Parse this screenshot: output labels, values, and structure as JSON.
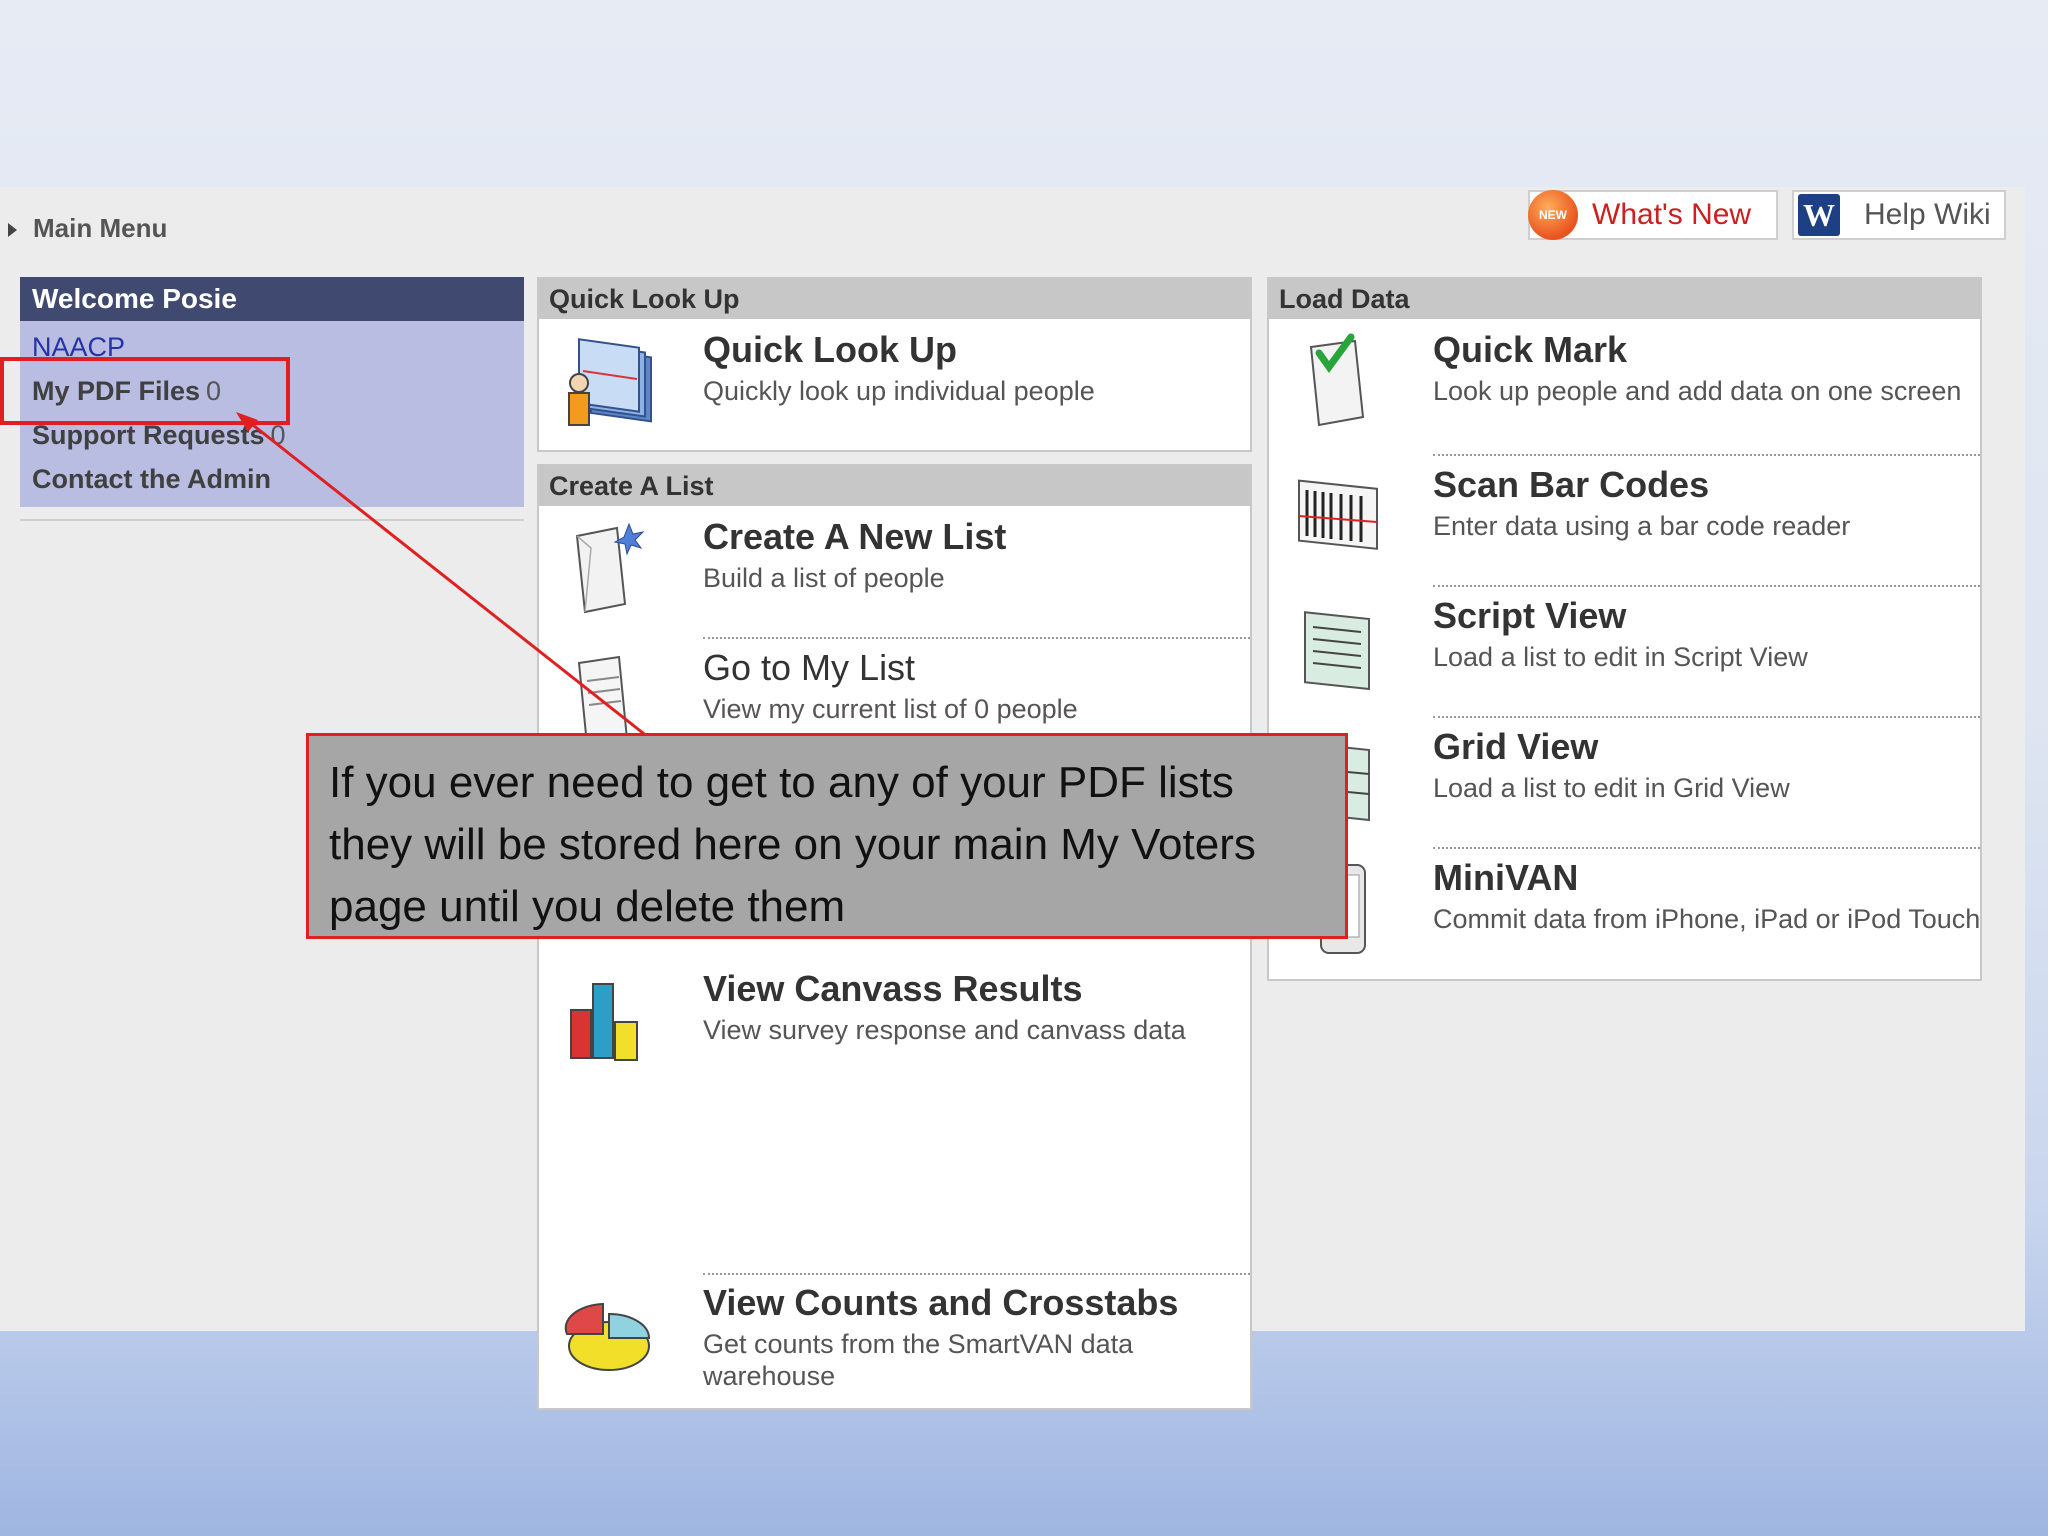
{
  "nav": {
    "main_menu": "Main Menu"
  },
  "toolbar": {
    "whats_new": "What's New",
    "new_badge": "NEW",
    "help_wiki": "Help Wiki",
    "wiki_badge": "W"
  },
  "welcome": {
    "title": "Welcome Posie",
    "org": "NAACP",
    "pdf_files_label": "My PDF Files",
    "pdf_files_count": "0",
    "support_label": "Support Requests",
    "support_count": "0",
    "contact": "Contact the Admin"
  },
  "quick_lookup": {
    "header": "Quick Look Up",
    "items": [
      {
        "title": "Quick Look Up",
        "desc": "Quickly look up individual people"
      }
    ]
  },
  "create_list": {
    "header": "Create A List",
    "items": [
      {
        "title": "Create A New List",
        "desc": "Build a list of people"
      },
      {
        "title": "Go to My List",
        "desc": "View my current list of 0 people"
      }
    ]
  },
  "analyze": {
    "items": [
      {
        "title": "View Canvass Results",
        "desc": "View survey response and canvass data"
      },
      {
        "title": "View Counts and Crosstabs",
        "desc": "Get counts from the SmartVAN data warehouse"
      }
    ]
  },
  "load_data": {
    "header": "Load Data",
    "items": [
      {
        "title": "Quick Mark",
        "desc": "Look up people and add data on one screen"
      },
      {
        "title": "Scan Bar Codes",
        "desc": "Enter data using a bar code reader"
      },
      {
        "title": "Script View",
        "desc": "Load a list to edit in Script View"
      },
      {
        "title": "Grid View",
        "desc": "Load a list to edit in Grid View"
      },
      {
        "title": "MiniVAN",
        "desc": "Commit data from iPhone, iPad or iPod Touch"
      }
    ]
  },
  "callout": {
    "text": "If you ever need to get to any of your PDF lists they will be stored here on your main My Voters page until you delete them"
  },
  "colors": {
    "accent_red": "#e02020",
    "welcome_header": "#404a70",
    "welcome_body": "#b9bde2"
  }
}
